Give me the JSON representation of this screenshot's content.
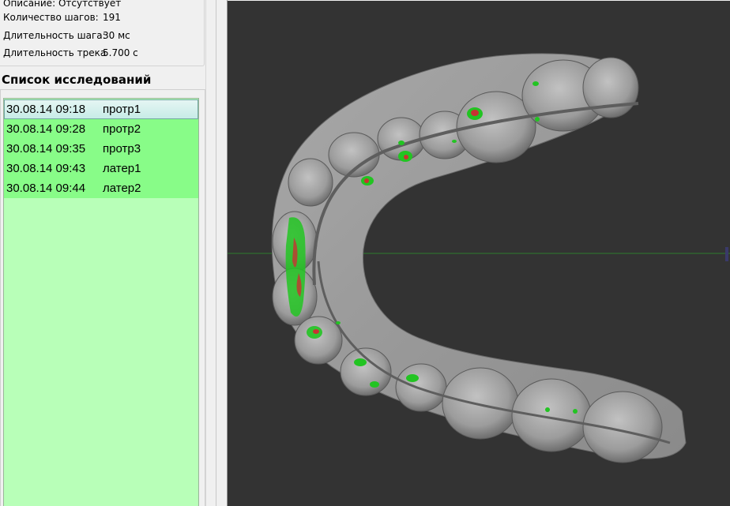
{
  "info": {
    "rows": [
      {
        "label": "Описание:",
        "value": "Отсутствует"
      },
      {
        "label": "Количество шагов:",
        "value": "191"
      },
      {
        "label": "Длительность шага:",
        "value": "30 мс"
      },
      {
        "label": "Длительность трека",
        "value": "5.700 с"
      }
    ]
  },
  "studies": {
    "title": "Список исследований",
    "items": [
      {
        "datetime": "30.08.14 09:18",
        "name": "протр1",
        "selected": true
      },
      {
        "datetime": "30.08.14 09:28",
        "name": "протр2"
      },
      {
        "datetime": "30.08.14 09:35",
        "name": "протр3"
      },
      {
        "datetime": "30.08.14 09:43",
        "name": "латер1"
      },
      {
        "datetime": "30.08.14 09:44",
        "name": "латер2"
      }
    ]
  },
  "viewport": {
    "background": "#333333",
    "model_color": "#9a9a9a",
    "axis_color": "#2e7d2e",
    "contact_green": "#22c422",
    "contact_red": "#c83232"
  }
}
